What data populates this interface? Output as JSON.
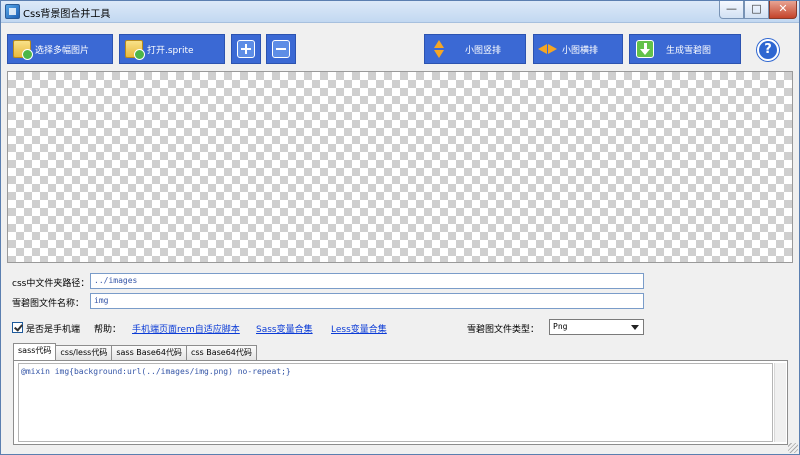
{
  "window": {
    "title": "Css背景图合并工具",
    "minimize_glyph": "—",
    "maximize_glyph": "□",
    "close_glyph": "✕"
  },
  "toolbar": {
    "select_images": "选择多幅图片",
    "open_sprite": "打开.sprite",
    "add_icon": "plus-icon",
    "remove_icon": "minus-icon",
    "vertical": "小图竖排",
    "horizontal": "小图横排",
    "generate": "生成雪碧图",
    "help": "?"
  },
  "form": {
    "css_path_label": "css中文件夹路径：",
    "css_path_value": "../images",
    "sprite_name_label": "雪碧图文件名称：",
    "sprite_name_value": "img",
    "mobile_label": "是否是手机端",
    "mobile_checked": true,
    "help_label": "帮助：",
    "links": [
      "手机端页面rem自适应脚本",
      "Sass变量合集",
      "Less变量合集"
    ],
    "filetype_label": "雪碧图文件类型：",
    "filetype_value": "Png"
  },
  "tabs": [
    {
      "label": "sass代码",
      "active": true
    },
    {
      "label": "css/less代码",
      "active": false
    },
    {
      "label": "sass Base64代码",
      "active": false
    },
    {
      "label": "css Base64代码",
      "active": false
    }
  ],
  "code": "@mixin img{background:url(../images/img.png) no-repeat;}",
  "colors": {
    "button_bg": "#3b69d4",
    "link": "#0b3bd6",
    "code_text": "#3455a7"
  }
}
